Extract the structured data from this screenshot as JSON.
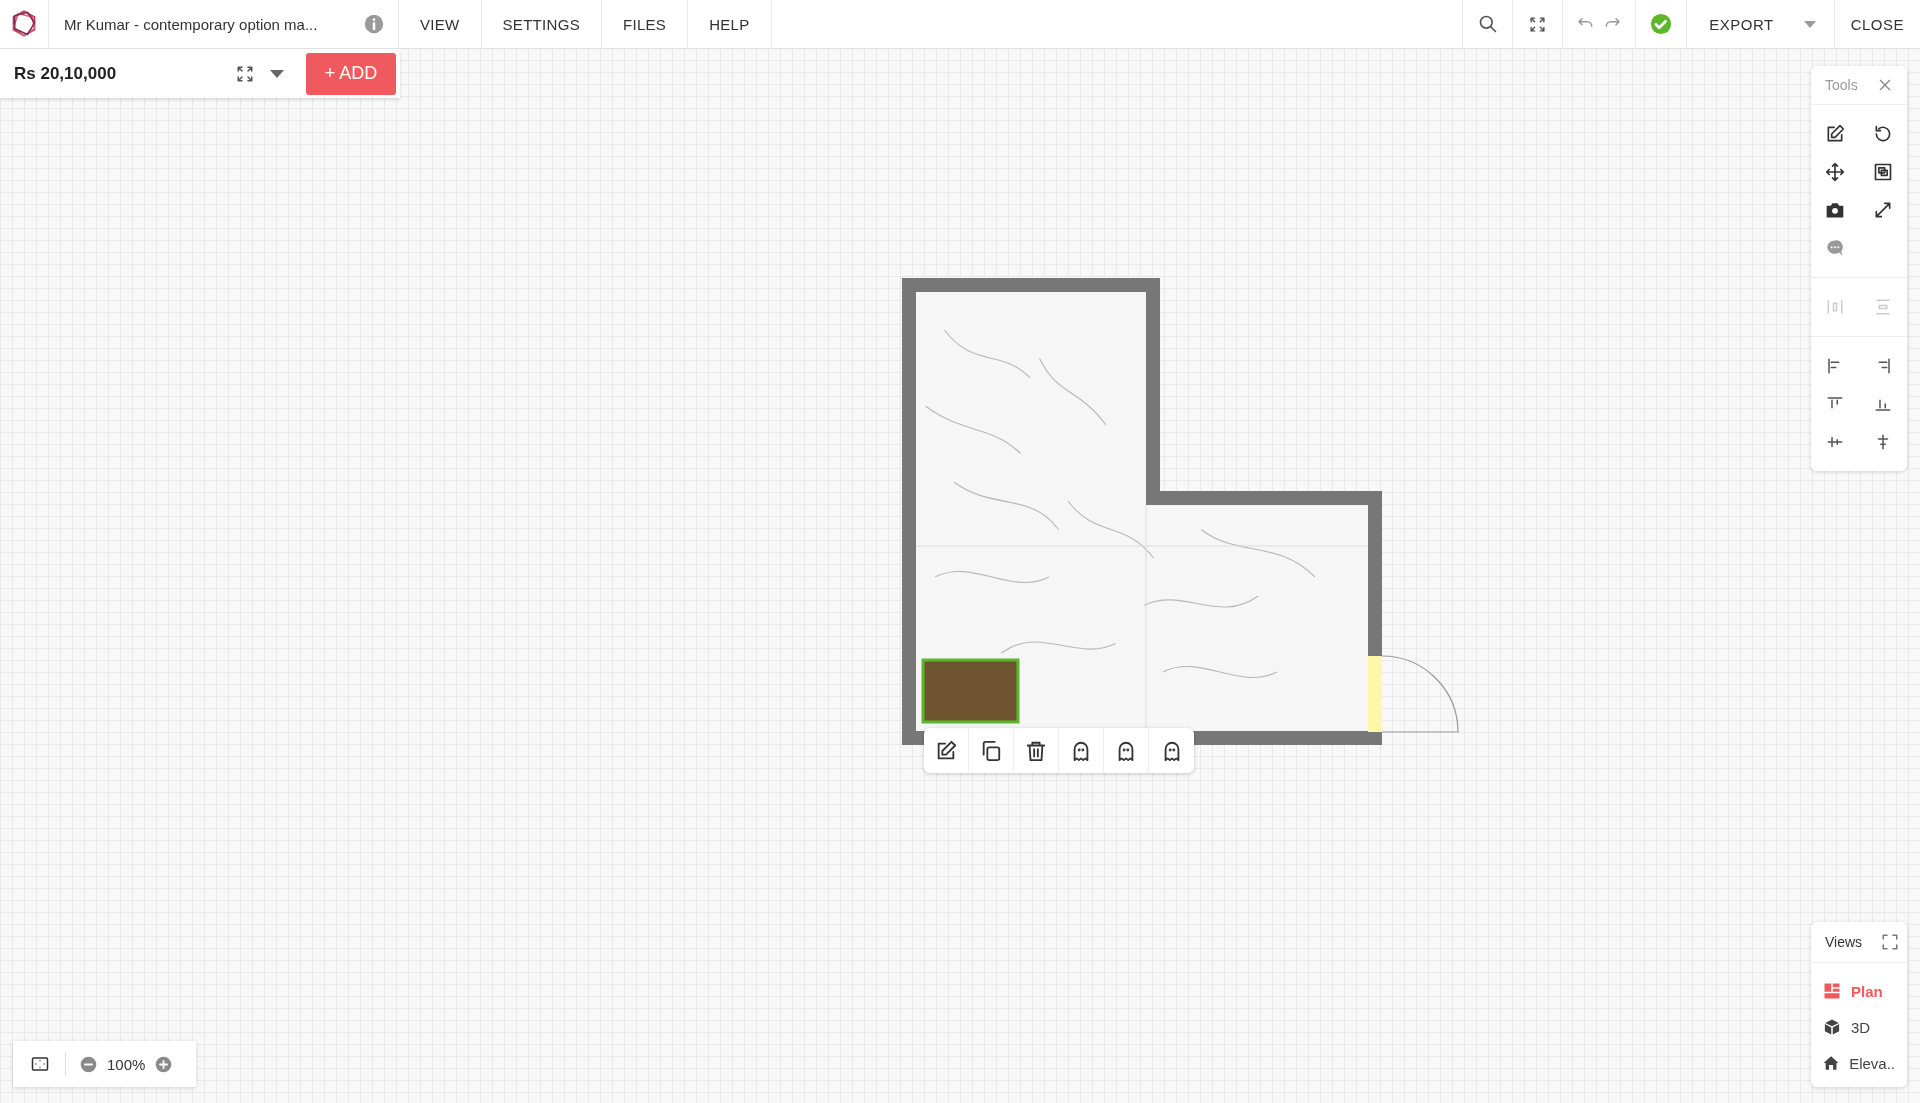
{
  "header": {
    "title": "Mr Kumar - contemporary option ma...",
    "menu": [
      {
        "label": "VIEW"
      },
      {
        "label": "SETTINGS"
      },
      {
        "label": "FILES"
      },
      {
        "label": "HELP"
      }
    ],
    "export": "EXPORT",
    "close": "CLOSE"
  },
  "budget": {
    "price": "Rs 20,10,000",
    "add": "+ ADD"
  },
  "tools": {
    "title": "Tools"
  },
  "views": {
    "title": "Views",
    "items": [
      {
        "kind": "plan",
        "label": "Plan",
        "selected": true
      },
      {
        "kind": "model",
        "label": "3D",
        "selected": false
      },
      {
        "kind": "elevation",
        "label": "Eleva..",
        "selected": false
      }
    ]
  },
  "zoom": {
    "value": "100%"
  }
}
